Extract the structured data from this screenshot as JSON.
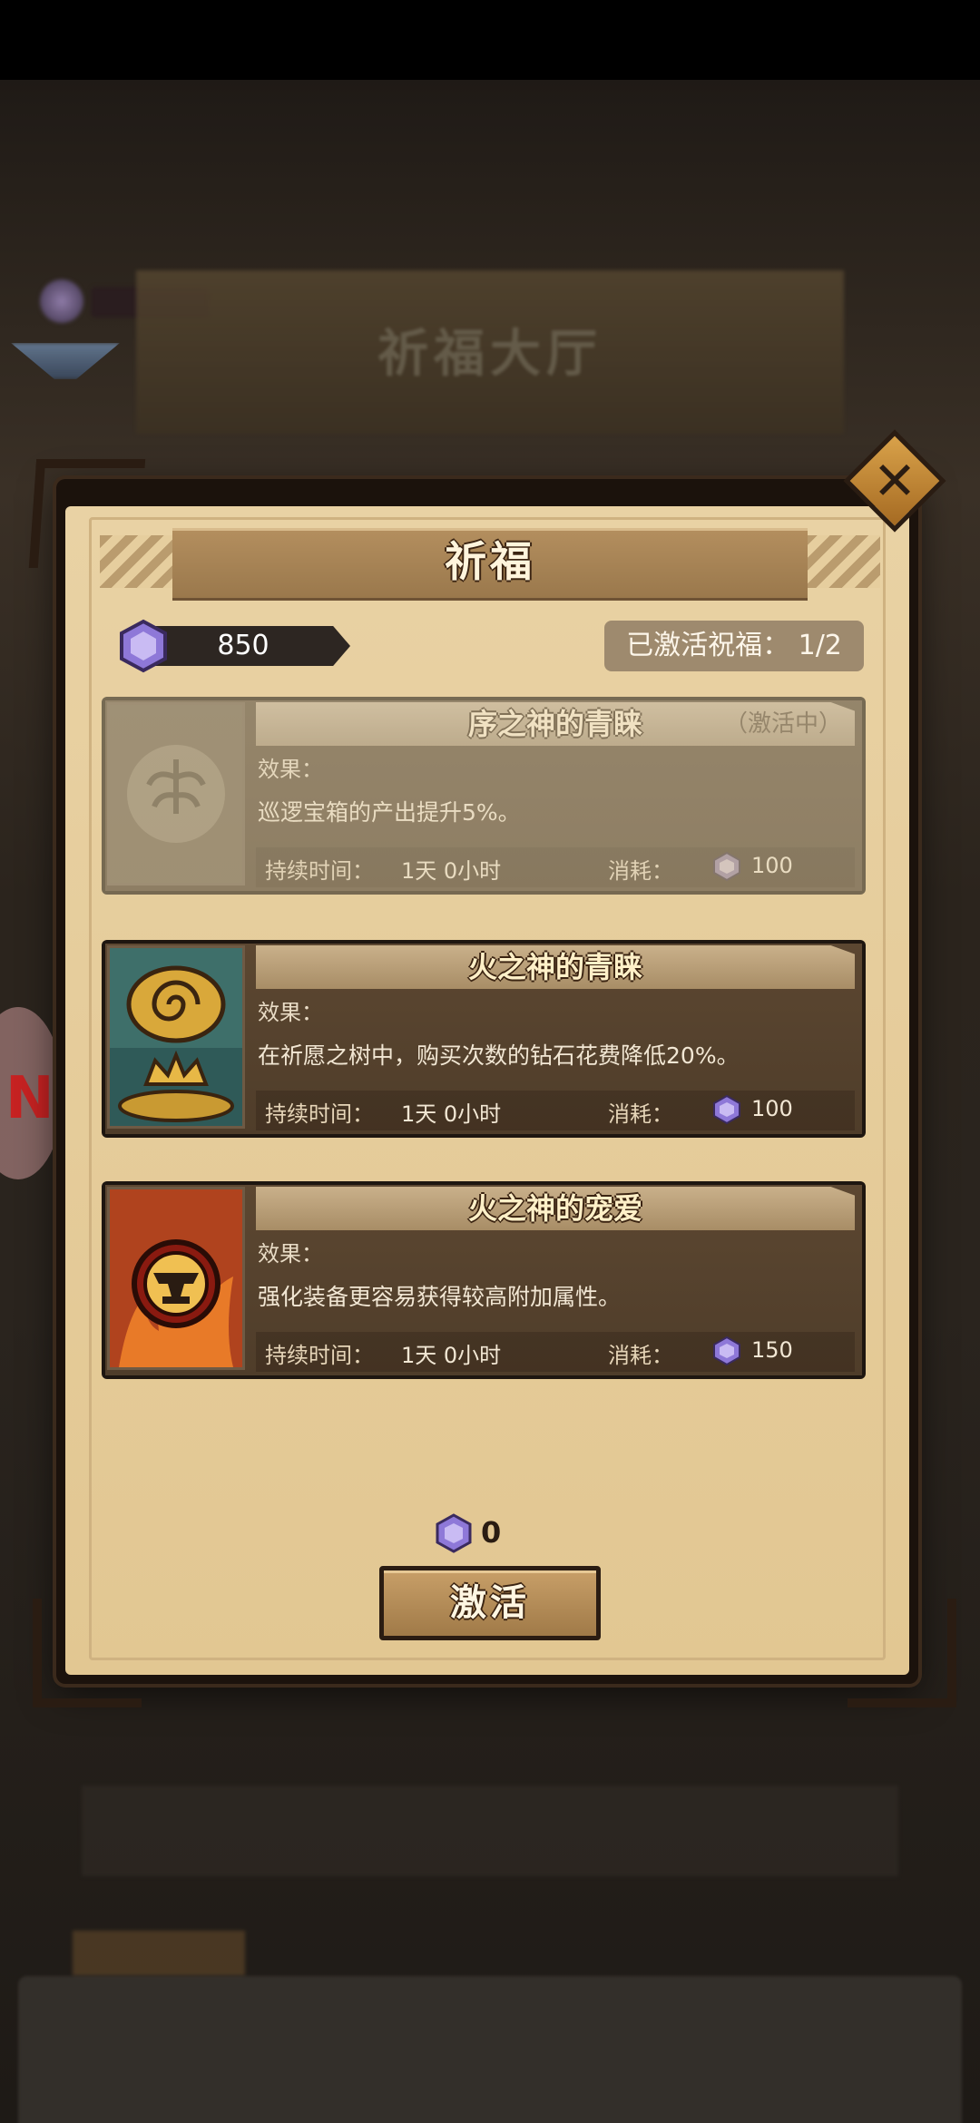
{
  "background": {
    "hall_title": "祈福大厅"
  },
  "dialog": {
    "title": "祈福",
    "gem_balance": "850",
    "active_blessings": "已激活祝福：  1/2",
    "close_icon": "close-icon"
  },
  "blessings": [
    {
      "name": "序之神的青睐",
      "state": "（激活中）",
      "effect_label": "效果：",
      "effect": "巡逻宝箱的产出提升5%。",
      "duration_label": "持续时间：",
      "duration": "1天 0小时",
      "cost_label": "消耗：",
      "cost": "100",
      "icon": "tree-of-life-icon",
      "enabled": false
    },
    {
      "name": "火之神的青睐",
      "state": "",
      "effect_label": "效果：",
      "effect": "在祈愿之树中，购买次数的钻石花费降低20%。",
      "duration_label": "持续时间：",
      "duration": "1天 0小时",
      "cost_label": "消耗：",
      "cost": "100",
      "icon": "spiral-crown-icon",
      "enabled": true
    },
    {
      "name": "火之神的宠爱",
      "state": "",
      "effect_label": "效果：",
      "effect": "强化装备更容易获得较高附加属性。",
      "duration_label": "持续时间：",
      "duration": "1天 0小时",
      "cost_label": "消耗：",
      "cost": "150",
      "icon": "anvil-flame-icon",
      "enabled": true
    }
  ],
  "footer": {
    "selected_cost": "0",
    "activate_label": "激活"
  },
  "colors": {
    "gem": "#8e78d8",
    "panel": "#e6cd9c",
    "card": "#5c4731"
  }
}
